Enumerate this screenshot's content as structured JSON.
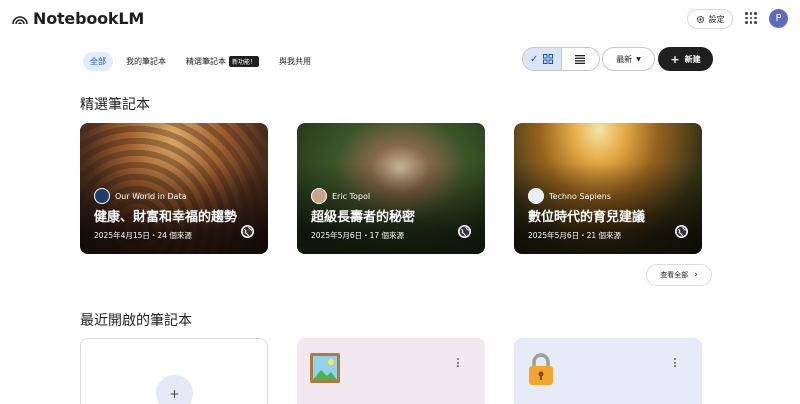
{
  "header": {
    "app_name": "NotebookLM",
    "settings_label": "設定",
    "avatar_initial": "P"
  },
  "tabs": [
    {
      "label": "全部",
      "active": true
    },
    {
      "label": "我的筆記本",
      "active": false
    },
    {
      "label": "精選筆記本",
      "active": false,
      "badge": "新功能！"
    },
    {
      "label": "與我共用",
      "active": false
    }
  ],
  "toolbar": {
    "sort_label": "最新",
    "new_label": "新建"
  },
  "featured": {
    "title": "精選筆記本",
    "view_all_label": "查看全部",
    "cards": [
      {
        "source": "Our World in Data",
        "title": "健康、財富和幸福的趨勢",
        "meta": "2025年4月15日・24 個來源"
      },
      {
        "source": "Eric Topol",
        "title": "超級長壽者的秘密",
        "meta": "2025年5月6日・17 個來源"
      },
      {
        "source": "Techno Sapiens",
        "title": "數位時代的育兒建議",
        "meta": "2025年5月6日・21 個來源"
      }
    ]
  },
  "recent": {
    "title": "最近開啟的筆記本"
  },
  "colors": {
    "accent": "#0b57d0",
    "primary_button": "#1f1f1f"
  }
}
